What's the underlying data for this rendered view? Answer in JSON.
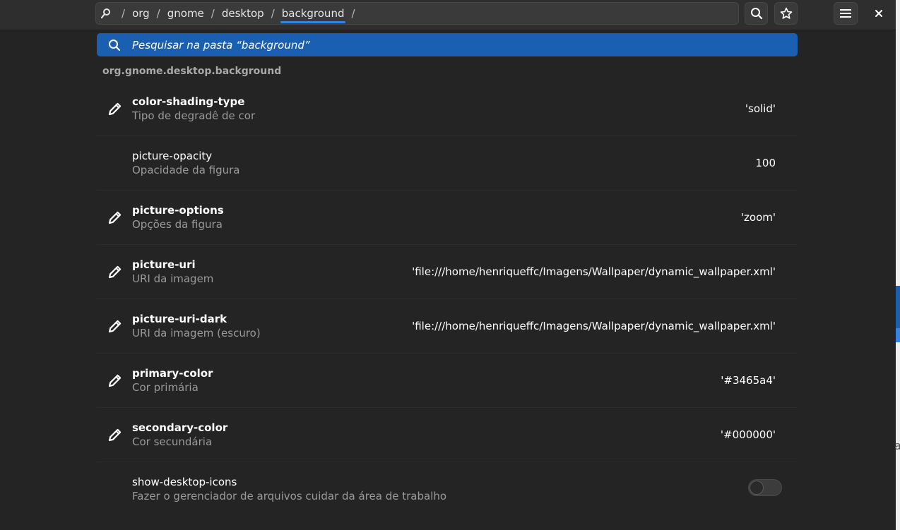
{
  "path": {
    "root_icon": "search-folder-icon",
    "separator": "/",
    "segments": [
      "org",
      "gnome",
      "desktop",
      "background"
    ],
    "trailing_separator": "/"
  },
  "header": {
    "search_button_icon": "search-icon",
    "bookmark_button_icon": "star-icon",
    "menu_button_icon": "hamburger-menu-icon",
    "close_button_icon": "close-icon"
  },
  "search": {
    "icon": "search-icon",
    "placeholder": "Pesquisar na pasta “background”"
  },
  "schema": {
    "title": "org.gnome.desktop.background"
  },
  "keys": [
    {
      "name": "color-shading-type",
      "description": "Tipo de degradê de cor",
      "value": "'solid'",
      "modified": true
    },
    {
      "name": "picture-opacity",
      "description": "Opacidade da figura",
      "value": "100",
      "modified": false
    },
    {
      "name": "picture-options",
      "description": "Opções da figura",
      "value": "'zoom'",
      "modified": true
    },
    {
      "name": "picture-uri",
      "description": "URI da imagem",
      "value": "'file:///home/henriqueffc/Imagens/Wallpaper/dynamic_wallpaper.xml'",
      "modified": true
    },
    {
      "name": "picture-uri-dark",
      "description": "URI da imagem (escuro)",
      "value": "'file:///home/henriqueffc/Imagens/Wallpaper/dynamic_wallpaper.xml'",
      "modified": true
    },
    {
      "name": "primary-color",
      "description": "Cor primária",
      "value": "'#3465a4'",
      "modified": true
    },
    {
      "name": "secondary-color",
      "description": "Cor secundária",
      "value": "'#000000'",
      "modified": true
    },
    {
      "name": "show-desktop-icons",
      "description": "Fazer o gerenciador de arquivos cuidar da área de trabalho",
      "value": "",
      "modified": false,
      "toggle_on": false
    }
  ],
  "colors": {
    "accent": "#3584e4",
    "search_bg": "#1b5fb2",
    "window_bg": "#242424"
  },
  "edge_glyph": "a"
}
